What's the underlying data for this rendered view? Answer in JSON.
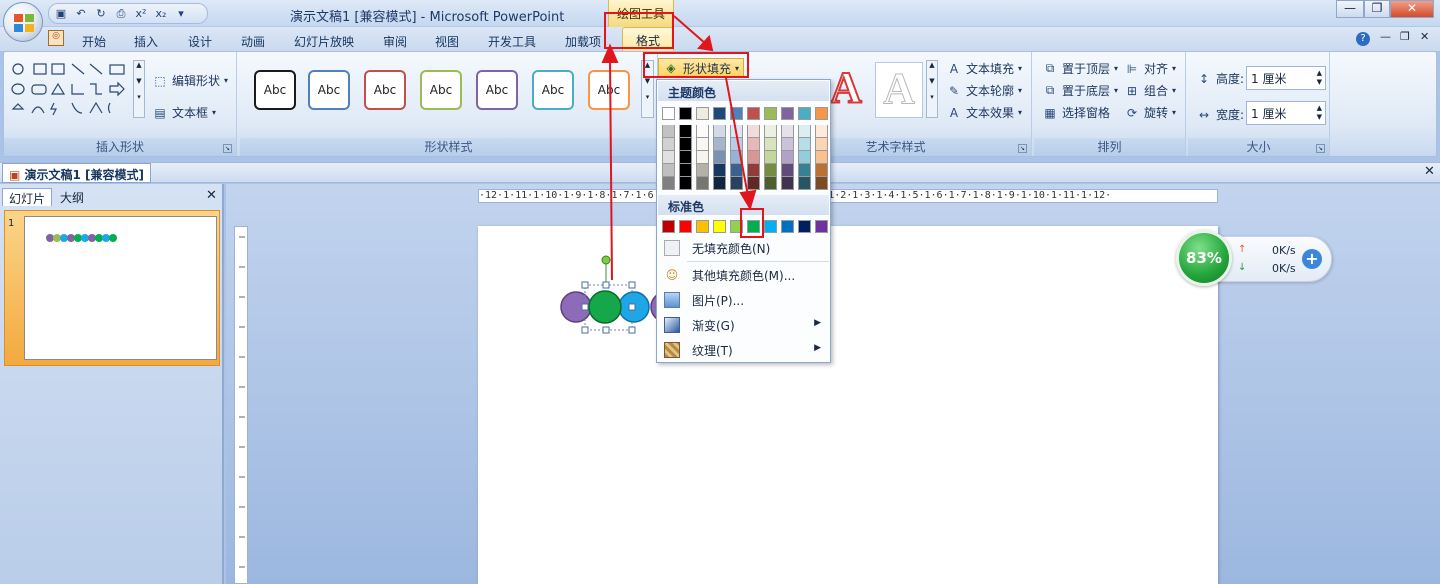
{
  "window": {
    "title": "演示文稿1 [兼容模式] - Microsoft PowerPoint",
    "contextual_tools": "绘图工具",
    "controls": [
      "—",
      "❐",
      "✕"
    ]
  },
  "qat": [
    "save-icon",
    "undo-icon",
    "redo-icon",
    "print-preview-icon",
    "superscript-icon",
    "subscript-icon"
  ],
  "tabs": [
    "开始",
    "插入",
    "设计",
    "动画",
    "幻灯片放映",
    "审阅",
    "视图",
    "开发工具",
    "加载项",
    "格式"
  ],
  "ribbon": {
    "insert_shapes": {
      "label": "插入形状",
      "edit_shape": "编辑形状",
      "textbox": "文本框"
    },
    "shape_styles": {
      "label": "形状样式",
      "abc": "Abc",
      "fill_button": "形状填充"
    },
    "wordart": {
      "label": "艺术字样式",
      "text_fill": "文本填充",
      "text_outline": "文本轮廓",
      "text_effects": "文本效果"
    },
    "arrange": {
      "label": "排列",
      "bring_front": "置于顶层",
      "send_back": "置于底层",
      "selection_pane": "选择窗格",
      "align": "对齐",
      "group": "组合",
      "rotate": "旋转"
    },
    "size": {
      "label": "大小",
      "height_label": "高度:",
      "height_value": "1 厘米",
      "width_label": "宽度:",
      "width_value": "1 厘米"
    }
  },
  "doc_tab": "演示文稿1 [兼容模式]",
  "left_panel": {
    "tab_slides": "幻灯片",
    "tab_outline": "大纲",
    "slide_number": "1"
  },
  "ruler_text": "·12·1·11·1·10·1·9·1·8·1·7·1·6·1·5·1·4·1·3·1·2·1·1·1·0·1·1·1·2·1·3·1·4·1·5·1·6·1·7·1·8·1·9·1·10·1·11·1·12·",
  "dropdown": {
    "theme_colors_title": "主题颜色",
    "standard_colors_title": "标准色",
    "theme_top": [
      "#ffffff",
      "#000000",
      "#eeece1",
      "#1f497d",
      "#4f81bd",
      "#c0504d",
      "#9bbb59",
      "#8064a2",
      "#4bacc6",
      "#f79646"
    ],
    "standard": [
      "#c00000",
      "#ff0000",
      "#ffc000",
      "#ffff00",
      "#92d050",
      "#00b050",
      "#00b0f0",
      "#0070c0",
      "#002060",
      "#7030a0"
    ],
    "items": [
      {
        "label": "无填充颜色(N)",
        "icon": "no-fill-icon"
      },
      {
        "label": "其他填充颜色(M)...",
        "icon": "palette-icon"
      },
      {
        "label": "图片(P)...",
        "icon": "picture-icon"
      },
      {
        "label": "渐变(G)",
        "icon": "gradient-icon"
      },
      {
        "label": "纹理(T)",
        "icon": "texture-icon"
      }
    ]
  },
  "speed_widget": {
    "percent": "83%",
    "up": "0K/s",
    "down": "0K/s"
  },
  "colors": {
    "accent_red": "#e0161c",
    "purple": "#8064a2",
    "green": "#00b050",
    "blue": "#1ea7e8"
  }
}
